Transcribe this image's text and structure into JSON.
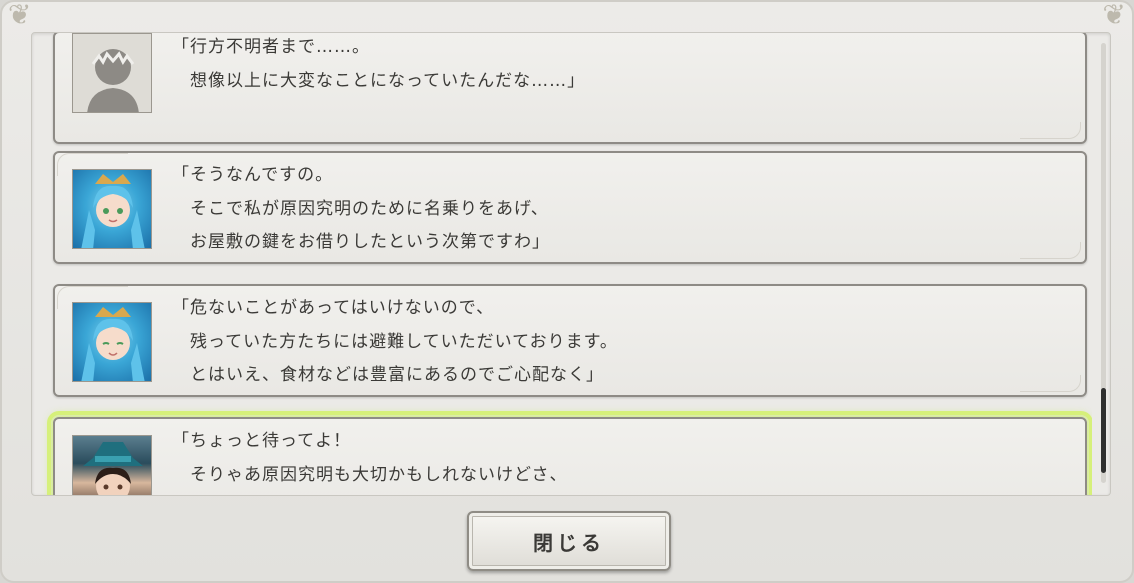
{
  "dialog_log": {
    "entries": [
      {
        "speaker_icon": "unknown-silhouette-icon",
        "lines": [
          "「行方不明者まで……。",
          "　想像以上に大変なことになっていたんだな……」"
        ]
      },
      {
        "speaker_icon": "blue-haired-girl-portrait",
        "lines": [
          "「そうなんですの。",
          "　そこで私が原因究明のために名乗りをあげ、",
          "　お屋敷の鍵をお借りしたという次第ですわ」"
        ]
      },
      {
        "speaker_icon": "blue-haired-girl-portrait",
        "lines": [
          "「危ないことがあってはいけないので、",
          "　残っていた方たちには避難していただいております。",
          "　とはいえ、食材などは豊富にあるのでご心配なく」"
        ]
      },
      {
        "speaker_icon": "dark-haired-hat-character-portrait",
        "lines": [
          "「ちょっと待ってよ！",
          "　そりゃあ原因究明も大切かもしれないけどさ、"
        ]
      }
    ]
  },
  "close_button": {
    "label": "閉じる"
  },
  "colors": {
    "highlight": "#d6f07a",
    "panel": "#ebeae7",
    "text": "#3b3a37"
  }
}
